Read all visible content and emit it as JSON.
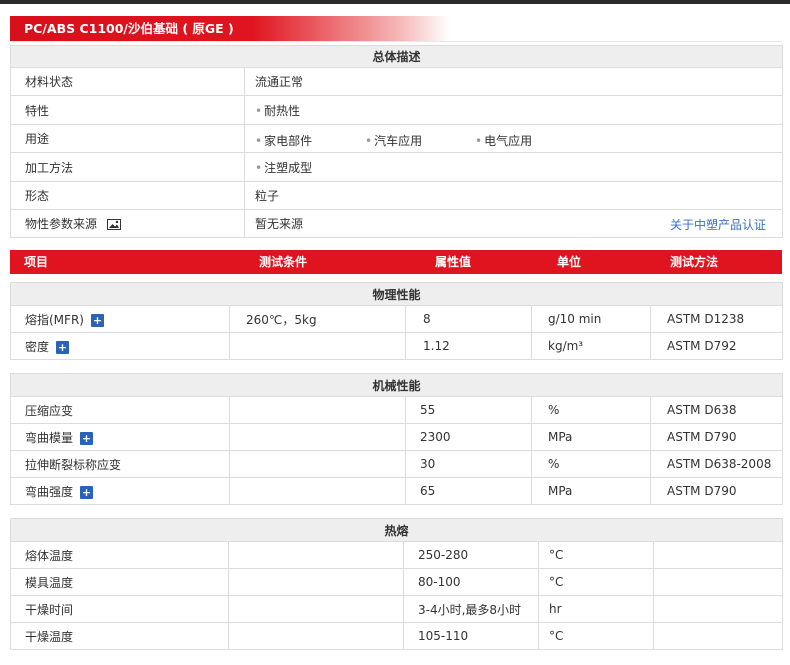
{
  "title": "PC/ABS C1100/沙伯基础 ( 原GE )",
  "overview": {
    "heading": "总体描述",
    "rows": [
      {
        "label": "材料状态",
        "value": "流通正常"
      },
      {
        "label": "特性",
        "items": [
          "耐热性"
        ]
      },
      {
        "label": "用途",
        "items": [
          "家电部件",
          "汽车应用",
          "电气应用"
        ]
      },
      {
        "label": "加工方法",
        "items": [
          "注塑成型"
        ]
      },
      {
        "label": "形态",
        "value": "粒子"
      },
      {
        "label": "物性参数来源",
        "value": "暂无来源",
        "link": "关于中塑产品认证"
      }
    ]
  },
  "columns": {
    "item": "项目",
    "condition": "测试条件",
    "value": "属性值",
    "unit": "单位",
    "method": "测试方法"
  },
  "physical": {
    "heading": "物理性能",
    "rows": [
      {
        "name": "熔指(MFR)",
        "cond": "260℃，5kg",
        "value": "8",
        "unit": "g/10 min",
        "method": "ASTM D1238",
        "plus": "+"
      },
      {
        "name": "密度",
        "cond": "",
        "value": "1.12",
        "unit": "kg/m³",
        "method": "ASTM D792",
        "plus": "+"
      }
    ]
  },
  "mechanical": {
    "heading": "机械性能",
    "rows": [
      {
        "name": "压缩应变",
        "cond": "",
        "value": "55",
        "unit": "%",
        "method": "ASTM D638"
      },
      {
        "name": "弯曲模量",
        "cond": "",
        "value": "2300",
        "unit": "MPa",
        "method": "ASTM D790",
        "plus": "+"
      },
      {
        "name": "拉伸断裂标称应变",
        "cond": "",
        "value": "30",
        "unit": "%",
        "method": "ASTM D638-2008"
      },
      {
        "name": "弯曲强度",
        "cond": "",
        "value": "65",
        "unit": "MPa",
        "method": "ASTM D790",
        "plus": "+"
      }
    ]
  },
  "thermal": {
    "heading": "热熔",
    "rows": [
      {
        "name": "熔体温度",
        "cond": "",
        "value": "250-280",
        "unit": "°C",
        "method": ""
      },
      {
        "name": "模具温度",
        "cond": "",
        "value": "80-100",
        "unit": "°C",
        "method": ""
      },
      {
        "name": "干燥时间",
        "cond": "",
        "value": "3-4小时,最多8小时",
        "unit": "hr",
        "method": ""
      },
      {
        "name": "干燥温度",
        "cond": "",
        "value": "105-110",
        "unit": "°C",
        "method": ""
      }
    ]
  },
  "colors": {
    "accent_red": "#e0141f",
    "link_blue": "#3a6fc4",
    "plus_blue": "#2a62b8",
    "section_bg": "#eeeeee"
  }
}
